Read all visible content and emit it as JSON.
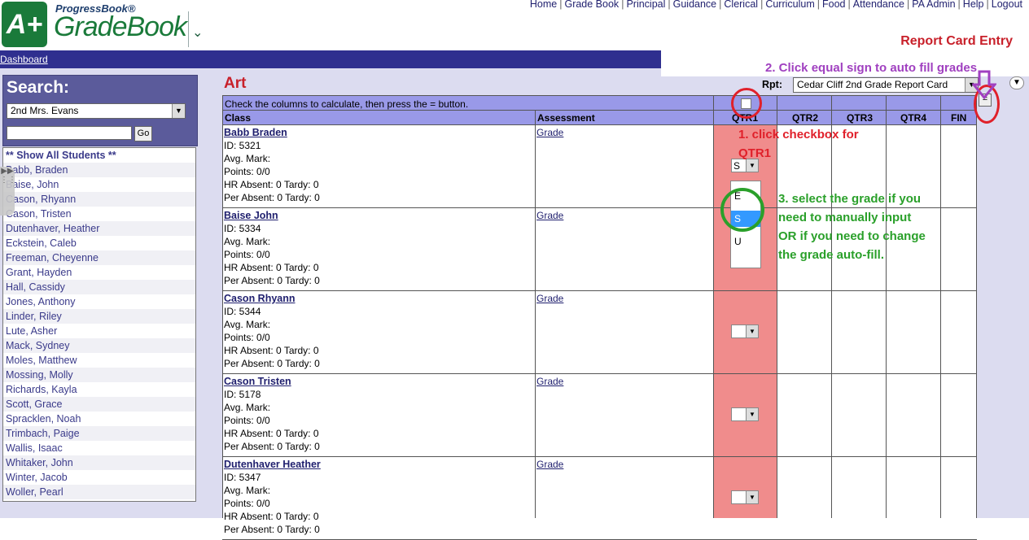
{
  "brand": {
    "logo": "A+",
    "product_small": "ProgressBook®",
    "product_big": "GradeBook"
  },
  "topnav": [
    "Home",
    "Grade Book",
    "Principal",
    "Guidance",
    "Clerical",
    "Curriculum",
    "Food",
    "Attendance",
    "PA Admin",
    "Help",
    "Logout"
  ],
  "page_heading": "Report Card Entry",
  "dashboard_link": "Dashboard",
  "search": {
    "title": "Search:",
    "class_value": "2nd Mrs. Evans",
    "input_value": "",
    "go_label": "Go"
  },
  "student_list": {
    "show_all": "** Show All Students **",
    "items": [
      "Babb, Braden",
      "Baise, John",
      "Cason, Rhyann",
      "Cason, Tristen",
      "Dutenhaver, Heather",
      "Eckstein, Caleb",
      "Freeman, Cheyenne",
      "Grant, Hayden",
      "Hall, Cassidy",
      "Jones, Anthony",
      "Linder, Riley",
      "Lute, Asher",
      "Mack, Sydney",
      "Moles, Matthew",
      "Mossing, Molly",
      "Richards, Kayla",
      "Scott, Grace",
      "Spracklen, Noah",
      "Trimbach, Paige",
      "Wallis, Isaac",
      "Whitaker, John",
      "Winter, Jacob",
      "Woller, Pearl"
    ]
  },
  "main": {
    "title": "Art",
    "rpt_label": "Rpt:",
    "rpt_value": "Cedar Cliff 2nd Grade Report Card",
    "instruction_row": "Check the columns to calculate, then press the = button.",
    "columns": {
      "class": "Class",
      "assessment": "Assessment",
      "qtr1": "QTR1",
      "qtr2": "QTR2",
      "qtr3": "QTR3",
      "qtr4": "QTR4",
      "fin": "FIN"
    }
  },
  "students": [
    {
      "name": "Babb Braden",
      "id": "ID: 5321",
      "avg": "Avg. Mark:",
      "points": "Points: 0/0",
      "hr": "HR Absent: 0 Tardy: 0",
      "per": "Per Absent: 0 Tardy: 0",
      "assessment": "Grade",
      "qtr1": "S"
    },
    {
      "name": "Baise John",
      "id": "ID: 5334",
      "avg": "Avg. Mark:",
      "points": "Points: 0/0",
      "hr": "HR Absent: 0 Tardy: 0",
      "per": "Per Absent: 0 Tardy: 0",
      "assessment": "Grade",
      "qtr1": ""
    },
    {
      "name": "Cason Rhyann",
      "id": "ID: 5344",
      "avg": "Avg. Mark:",
      "points": "Points: 0/0",
      "hr": "HR Absent: 0 Tardy: 0",
      "per": "Per Absent: 0 Tardy: 0",
      "assessment": "Grade",
      "qtr1": ""
    },
    {
      "name": "Cason Tristen",
      "id": "ID: 5178",
      "avg": "Avg. Mark:",
      "points": "Points: 0/0",
      "hr": "HR Absent: 0 Tardy: 0",
      "per": "Per Absent: 0 Tardy: 0",
      "assessment": "Grade",
      "qtr1": ""
    },
    {
      "name": "Dutenhaver Heather",
      "id": "ID: 5347",
      "avg": "Avg. Mark:",
      "points": "Points: 0/0",
      "hr": "HR Absent: 0 Tardy: 0",
      "per": "Per Absent: 0 Tardy: 0",
      "assessment": "Grade",
      "qtr1": ""
    }
  ],
  "dropdown_options": [
    "E",
    "S",
    "U"
  ],
  "dropdown_selected": "S",
  "annotations": {
    "step1": "1. click checkbox for QTR1",
    "step2": "2. Click equal sign to auto fill grades",
    "step3": "3. select the grade if you need to manually input OR if you need to change the grade auto-fill."
  },
  "colors": {
    "header_purple": "#9999e8",
    "dash_bar": "#2f2f8f",
    "qtr1_highlight": "#f08c8c",
    "title_red": "#c8202a",
    "step1_red": "#e0202a",
    "step2_purple": "#a040c0",
    "step3_green": "#2aa02a"
  }
}
